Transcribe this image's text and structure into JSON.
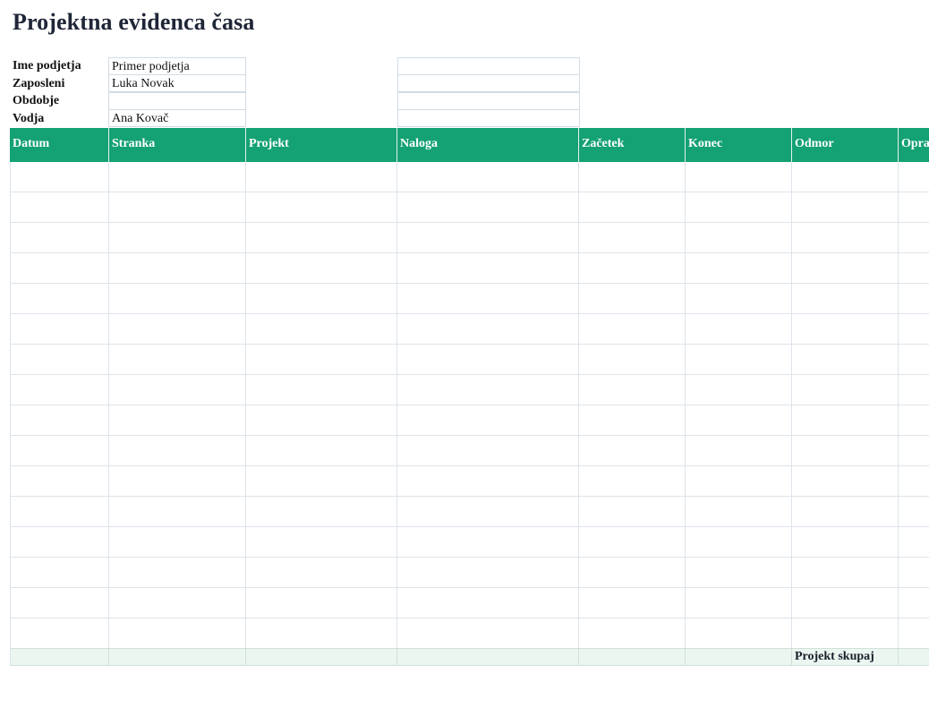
{
  "title": "Projektna evidenca časa",
  "info": {
    "labels": [
      "Ime podjetja",
      "Zaposleni",
      "Obdobje",
      "Vodja"
    ],
    "values": [
      "Primer podjetja",
      "Luka Novak",
      "",
      "Ana Kovač"
    ],
    "extra": [
      "",
      "",
      "",
      ""
    ]
  },
  "table": {
    "headers": [
      "Datum",
      "Stranka",
      "Projekt",
      "Naloga",
      "Začetek",
      "Konec",
      "Odmor",
      "Opravljeno"
    ],
    "rows": 16,
    "footer_label": "Projekt skupaj"
  },
  "colors": {
    "header_bg": "#14a173",
    "footer_bg": "#ebf6f0",
    "grid_line": "#dde4ea"
  }
}
